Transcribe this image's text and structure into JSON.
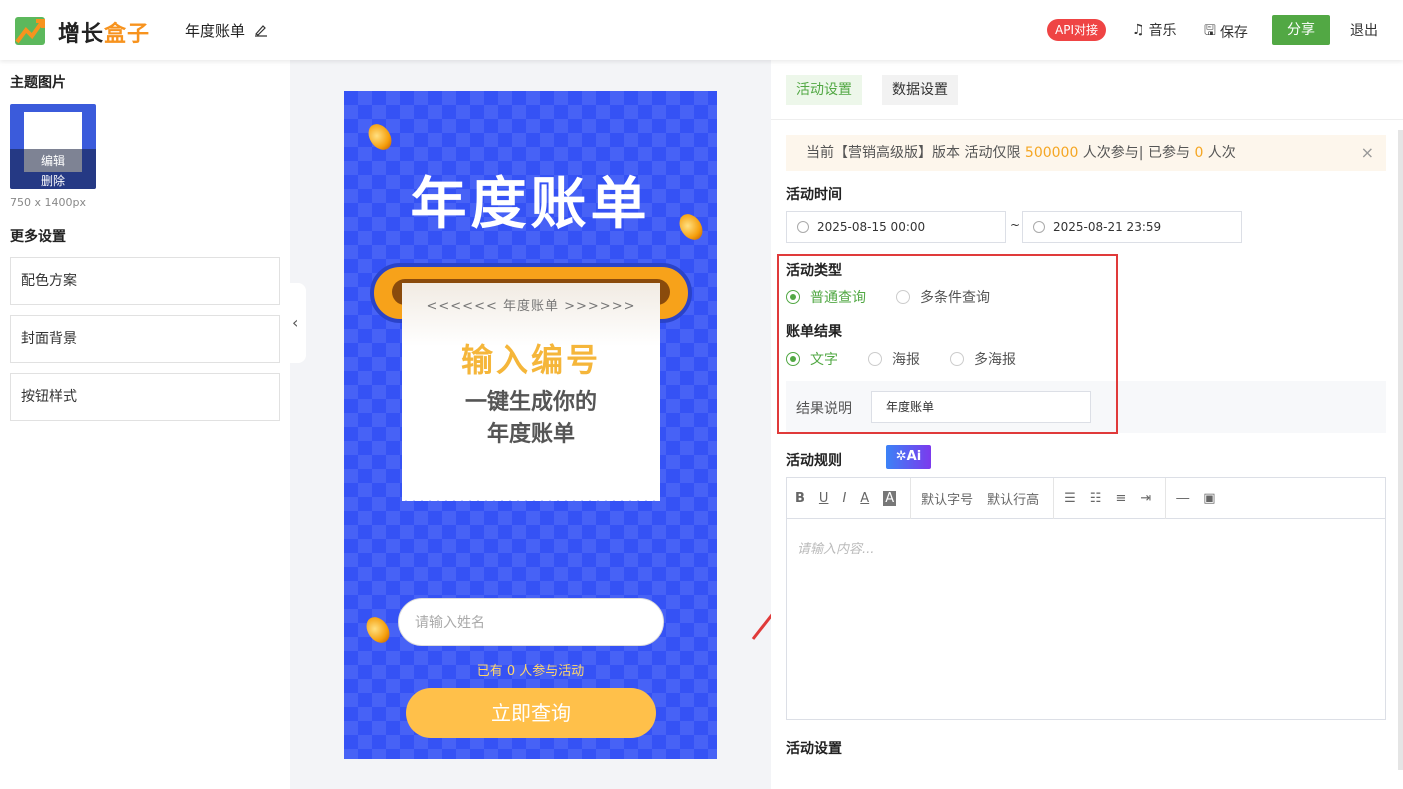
{
  "header": {
    "brand_a": "增长",
    "brand_b": "盒子",
    "title": "年度账单",
    "api_label": "API对接",
    "music_label": "音乐",
    "save_label": "保存",
    "share_label": "分享",
    "exit_label": "退出"
  },
  "left": {
    "theme_title": "主题图片",
    "edit_label": "编辑",
    "delete_label": "删除",
    "dims": "750 x 1400px",
    "more_title": "更多设置",
    "items": [
      {
        "label": "配色方案"
      },
      {
        "label": "封面背景"
      },
      {
        "label": "按钮样式"
      }
    ]
  },
  "preview": {
    "title": "年度账单",
    "receipt_header": "<<<<<< 年度账单 >>>>>>",
    "receipt_big": "输入编号",
    "receipt_line1": "一键生成你的",
    "receipt_line2": "年度账单",
    "name_placeholder": "请输入姓名",
    "count_text": "已有 0 人参与活动",
    "submit_label": "立即查询"
  },
  "right": {
    "tabs": [
      {
        "label": "活动设置"
      },
      {
        "label": "数据设置"
      }
    ],
    "notice": {
      "pre": "当前【营销高级版】版本 活动仅限 ",
      "limit": "500000",
      "mid": " 人次参与| 已参与 ",
      "joined": "0",
      "post": " 人次",
      "close": "×"
    },
    "time_label": "活动时间",
    "start": "2025-08-15 00:00",
    "sep": "~",
    "end": "2025-08-21 23:59",
    "type_label": "活动类型",
    "type_options": [
      {
        "label": "普通查询"
      },
      {
        "label": "多条件查询"
      }
    ],
    "result_label": "账单结果",
    "result_options": [
      {
        "label": "文字"
      },
      {
        "label": "海报"
      },
      {
        "label": "多海报"
      }
    ],
    "desc_label": "结果说明",
    "desc_value": "年度账单",
    "rules_label": "活动规则",
    "ai_label": "✲Ai",
    "editor": {
      "bold": "B",
      "underline": "U",
      "italic": "I",
      "font_color": "A",
      "bg_color": "A",
      "font_size": "默认字号",
      "line_height": "默认行高",
      "placeholder": "请输入内容..."
    },
    "settings_label": "活动设置"
  },
  "colors": {
    "accent": "#52a844",
    "blue": "#3552f5",
    "highlight": "#e03a3a",
    "warn": "#f5a623"
  }
}
